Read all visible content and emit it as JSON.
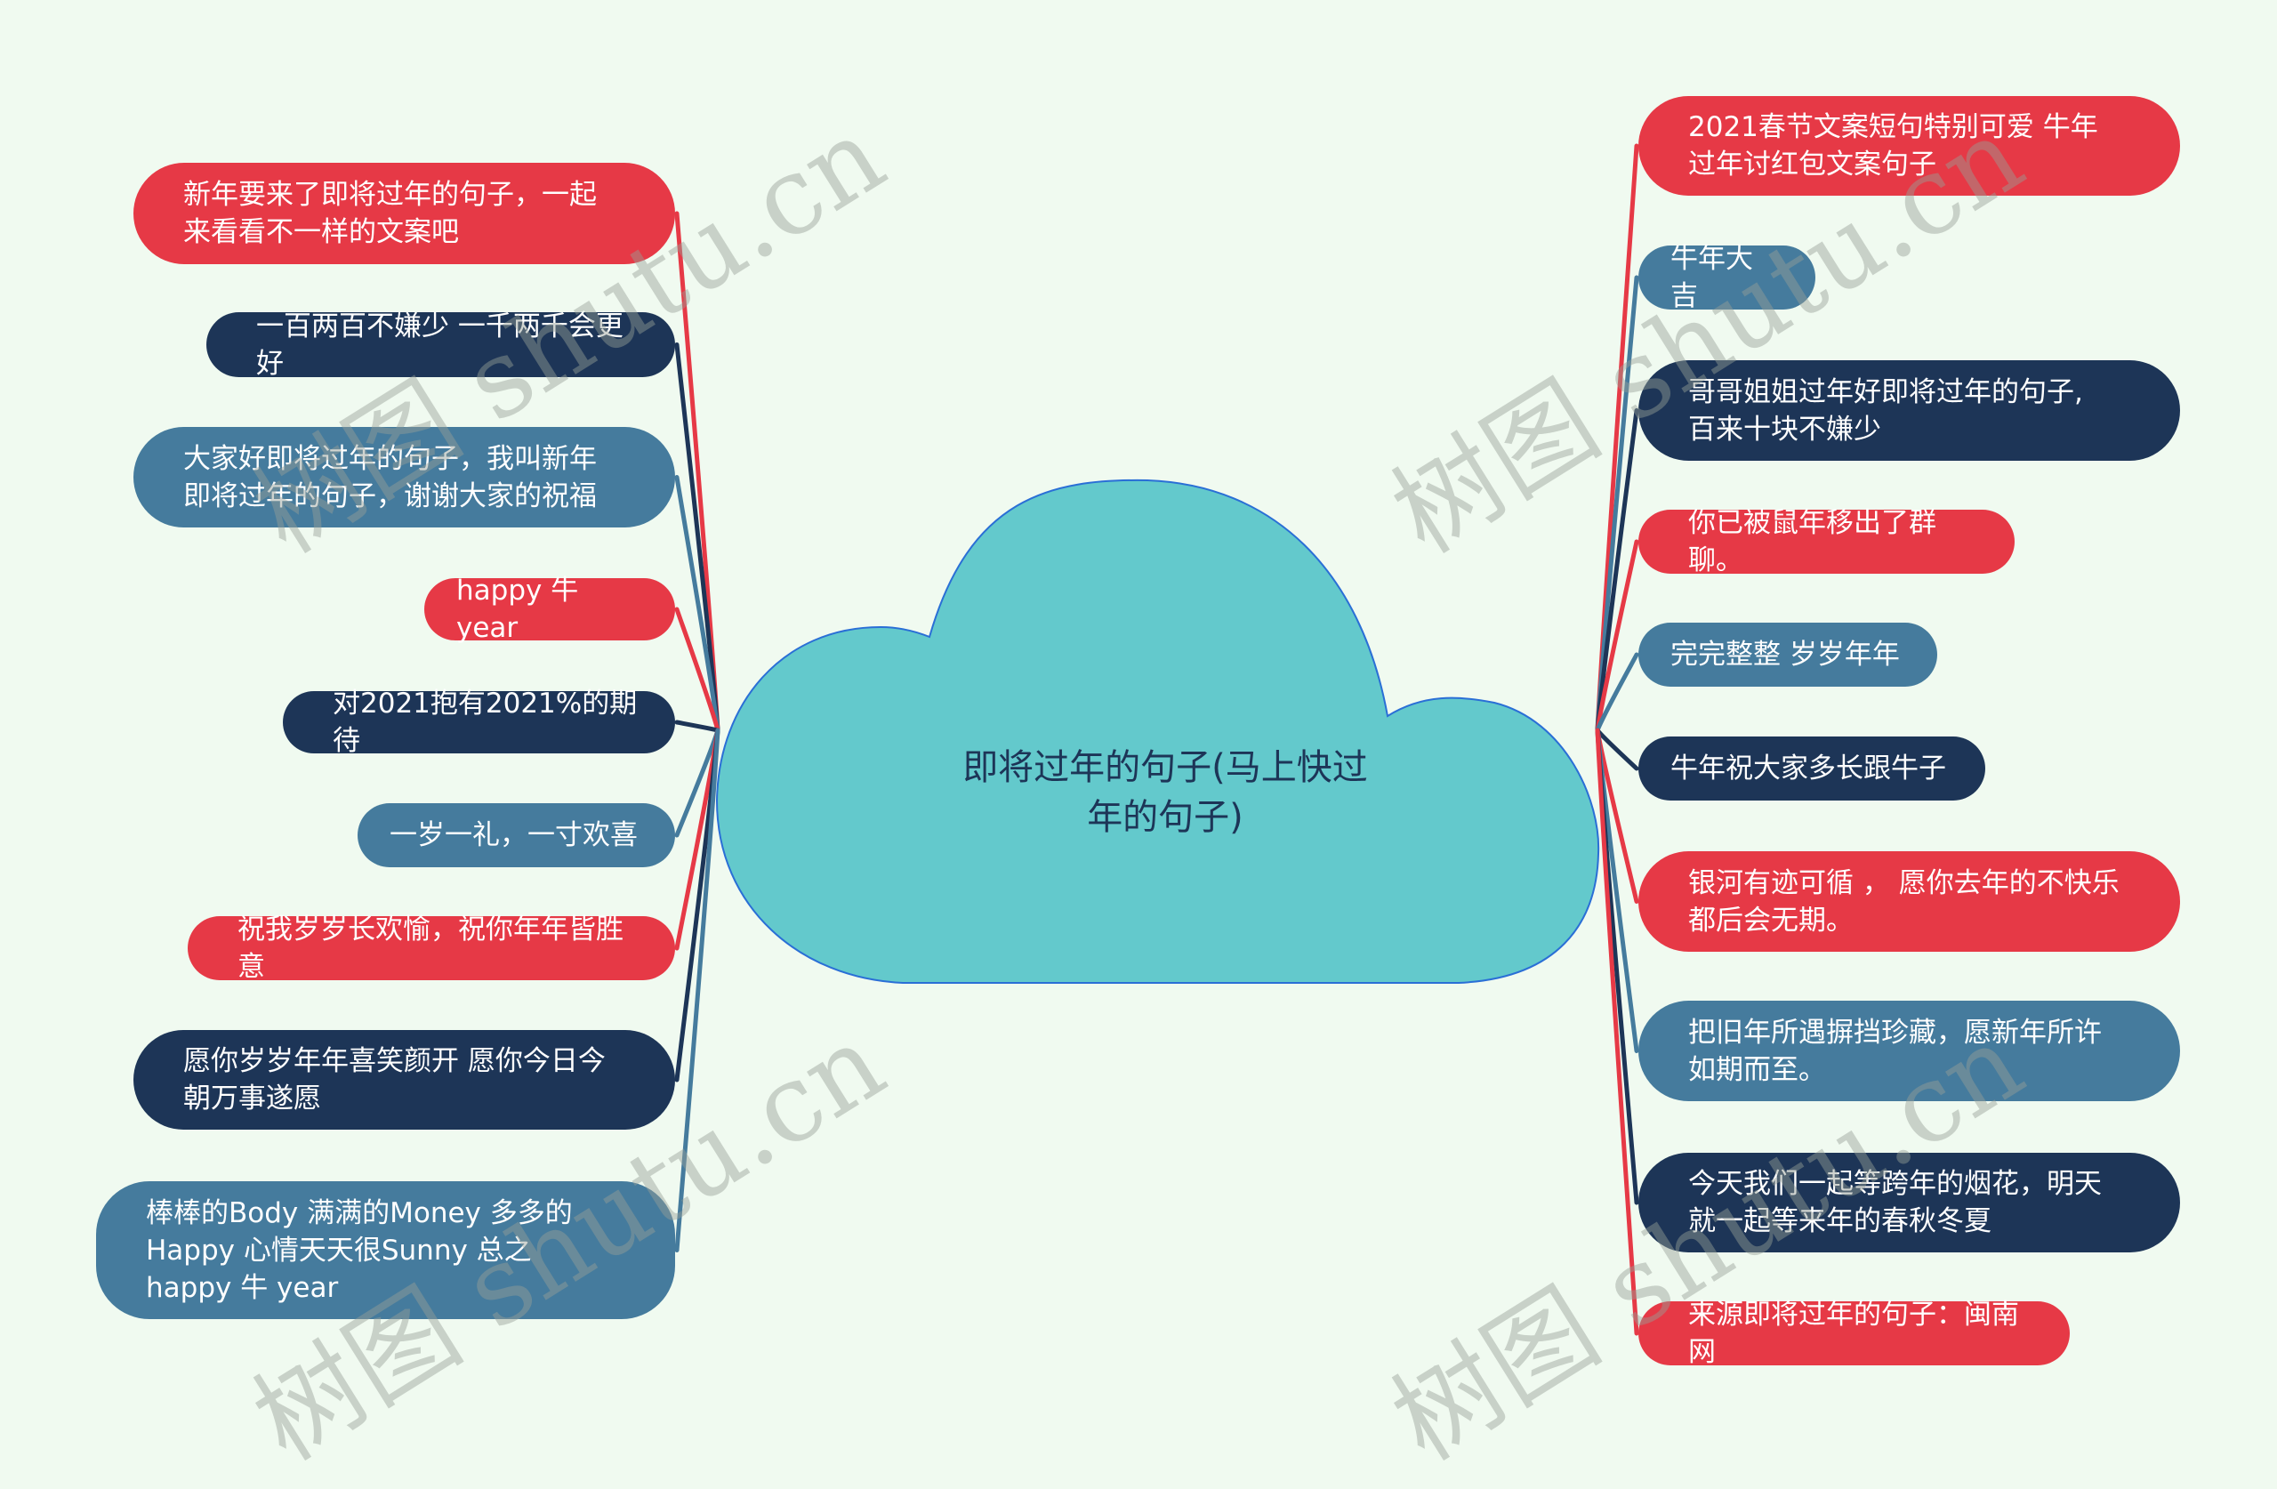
{
  "central_topic": {
    "text": "即将过年的句子(马上快过\n年的句子)",
    "fill_color": "#63c9cc",
    "stroke_color": "#2a6fd6"
  },
  "colors": {
    "red": "#e63946",
    "navy": "#1d3557",
    "steel": "#457b9d",
    "background": "#f0faf0"
  },
  "left_branches": [
    {
      "text": "新年要来了即将过年的句子，一起\n来看看不一样的文案吧",
      "color": "red"
    },
    {
      "text": "一百两百不嫌少 一千两千会更好",
      "color": "navy"
    },
    {
      "text": "大家好即将过年的句子，我叫新年\n即将过年的句子，谢谢大家的祝福",
      "color": "steel"
    },
    {
      "text": "happy 牛 year",
      "color": "red"
    },
    {
      "text": "对2021抱有2021%的期待",
      "color": "navy"
    },
    {
      "text": "一岁一礼，一寸欢喜",
      "color": "steel"
    },
    {
      "text": "祝我岁岁长欢愉，祝你年年皆胜意",
      "color": "red"
    },
    {
      "text": "愿你岁岁年年喜笑颜开 愿你今日今\n朝万事遂愿",
      "color": "navy"
    },
    {
      "text": "棒棒的Body 满满的Money 多多的\nHappy 心情天天很Sunny 总之\nhappy 牛 year",
      "color": "steel"
    }
  ],
  "right_branches": [
    {
      "text": "2021春节文案短句特别可爱 牛年\n过年讨红包文案句子",
      "color": "red"
    },
    {
      "text": "牛年大吉",
      "color": "steel"
    },
    {
      "text": "哥哥姐姐过年好即将过年的句子,\n百来十块不嫌少",
      "color": "navy"
    },
    {
      "text": "你已被鼠年移出了群聊。",
      "color": "red"
    },
    {
      "text": "完完整整 岁岁年年",
      "color": "steel"
    },
    {
      "text": "牛年祝大家多长跟牛子",
      "color": "navy"
    },
    {
      "text": "银河有迹可循 ， 愿你去年的不快乐\n都后会无期。",
      "color": "red"
    },
    {
      "text": "把旧年所遇摒挡珍藏，愿新年所许\n如期而至。",
      "color": "steel"
    },
    {
      "text": "今天我们一起等跨年的烟花，明天\n就一起等来年的春秋冬夏",
      "color": "navy"
    },
    {
      "text": "来源即将过年的句子：闽南网",
      "color": "red"
    }
  ],
  "watermark": {
    "text": "树图 shutu.cn"
  }
}
